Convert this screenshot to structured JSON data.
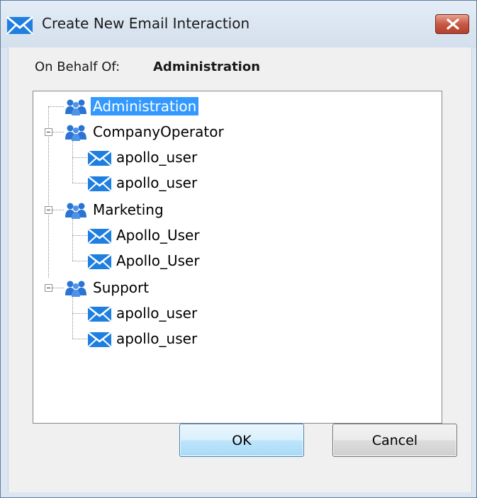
{
  "window": {
    "title": "Create New Email Interaction",
    "close_icon": "close-icon"
  },
  "on_behalf": {
    "label": "On Behalf Of:",
    "value": "Administration"
  },
  "tree": {
    "nodes": [
      {
        "label": "Administration",
        "icon": "group-icon",
        "selected": true
      },
      {
        "label": "CompanyOperator",
        "icon": "group-icon",
        "expanded": true,
        "children": [
          {
            "label": "apollo_user",
            "icon": "email-icon"
          },
          {
            "label": "apollo_user",
            "icon": "email-icon"
          }
        ]
      },
      {
        "label": "Marketing",
        "icon": "group-icon",
        "expanded": true,
        "children": [
          {
            "label": "Apollo_User",
            "icon": "email-icon"
          },
          {
            "label": "Apollo_User",
            "icon": "email-icon"
          }
        ]
      },
      {
        "label": "Support",
        "icon": "group-icon",
        "expanded": true,
        "children": [
          {
            "label": "apollo_user",
            "icon": "email-icon"
          },
          {
            "label": "apollo_user",
            "icon": "email-icon"
          }
        ]
      }
    ]
  },
  "buttons": {
    "ok": "OK",
    "cancel": "Cancel"
  },
  "colors": {
    "selection": "#3399ff",
    "email_icon": "#1f7fe0",
    "group_icon": "#2a74d4",
    "close_button": "#c75a45"
  }
}
